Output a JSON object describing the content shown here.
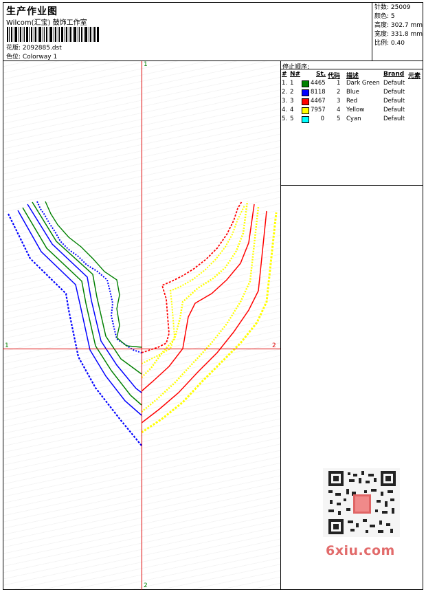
{
  "header": {
    "title": "生产作业图",
    "company": "Wilcom(汇宝) 鼓饰工作室",
    "design_label": "花版: 2092885.dst",
    "colorway_label": "色位:  Colorway 1"
  },
  "info": {
    "stitches": "针数: 25009",
    "colors": "颜色: 5",
    "height": "高度: 302.7 mm",
    "width": "宽度: 331.8 mm",
    "scale": "比例: 0.40"
  },
  "axes": {
    "top": "1",
    "bottom": "2",
    "left": "1",
    "right": "2"
  },
  "stop_sequence": {
    "title": "停止顺序:",
    "headers": {
      "num": "#",
      "needle": "N#",
      "stitches": "St.",
      "code": "代码",
      "desc": "描述",
      "brand": "Brand",
      "element": "元素"
    },
    "rows": [
      {
        "num": "1.",
        "needle": "1",
        "stitches": "4465",
        "code": "1",
        "desc": "Dark Green",
        "brand": "Default",
        "color": "#008000"
      },
      {
        "num": "2.",
        "needle": "2",
        "stitches": "8118",
        "code": "2",
        "desc": "Blue",
        "brand": "Default",
        "color": "#0000ff"
      },
      {
        "num": "3.",
        "needle": "3",
        "stitches": "4467",
        "code": "3",
        "desc": "Red",
        "brand": "Default",
        "color": "#ff0000"
      },
      {
        "num": "4.",
        "needle": "4",
        "stitches": "7957",
        "code": "4",
        "desc": "Yellow",
        "brand": "Default",
        "color": "#ffff00"
      },
      {
        "num": "5.",
        "needle": "5",
        "stitches": "0",
        "code": "5",
        "desc": "Cyan",
        "brand": "Default",
        "color": "#00ffff"
      }
    ]
  },
  "watermark": "6xiu.com"
}
